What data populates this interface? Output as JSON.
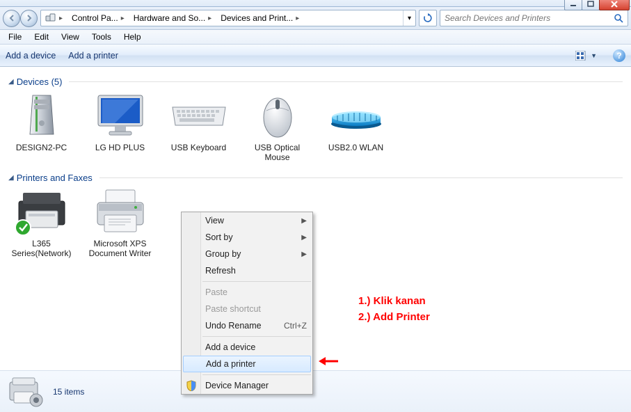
{
  "window": {
    "breadcrumb": [
      "Control Pa...",
      "Hardware and So...",
      "Devices and Print..."
    ],
    "search_placeholder": "Search Devices and Printers"
  },
  "menubar": [
    "File",
    "Edit",
    "View",
    "Tools",
    "Help"
  ],
  "toolbar": {
    "add_device": "Add a device",
    "add_printer": "Add a printer"
  },
  "groups": [
    {
      "title": "Devices",
      "count": 5,
      "items": [
        {
          "label": "DESIGN2-PC",
          "icon": "pc-tower"
        },
        {
          "label": "LG HD PLUS",
          "icon": "monitor"
        },
        {
          "label": "USB Keyboard",
          "icon": "keyboard"
        },
        {
          "label": "USB Optical Mouse",
          "icon": "mouse"
        },
        {
          "label": "USB2.0 WLAN",
          "icon": "wlan"
        }
      ]
    },
    {
      "title": "Printers and Faxes",
      "count": null,
      "items": [
        {
          "label": "L365 Series(Network)",
          "icon": "printer-default"
        },
        {
          "label": "Microsoft XPS Document Writer",
          "icon": "printer"
        }
      ]
    }
  ],
  "context_menu": {
    "view": "View",
    "sort_by": "Sort by",
    "group_by": "Group by",
    "refresh": "Refresh",
    "paste": "Paste",
    "paste_shortcut": "Paste shortcut",
    "undo_rename": "Undo Rename",
    "undo_shortcut": "Ctrl+Z",
    "add_device": "Add a device",
    "add_printer": "Add a printer",
    "device_manager": "Device Manager"
  },
  "details_bar": {
    "count_label": "15 items"
  },
  "annotation": {
    "line1": "1.) Klik kanan",
    "line2": "2.) Add Printer"
  }
}
